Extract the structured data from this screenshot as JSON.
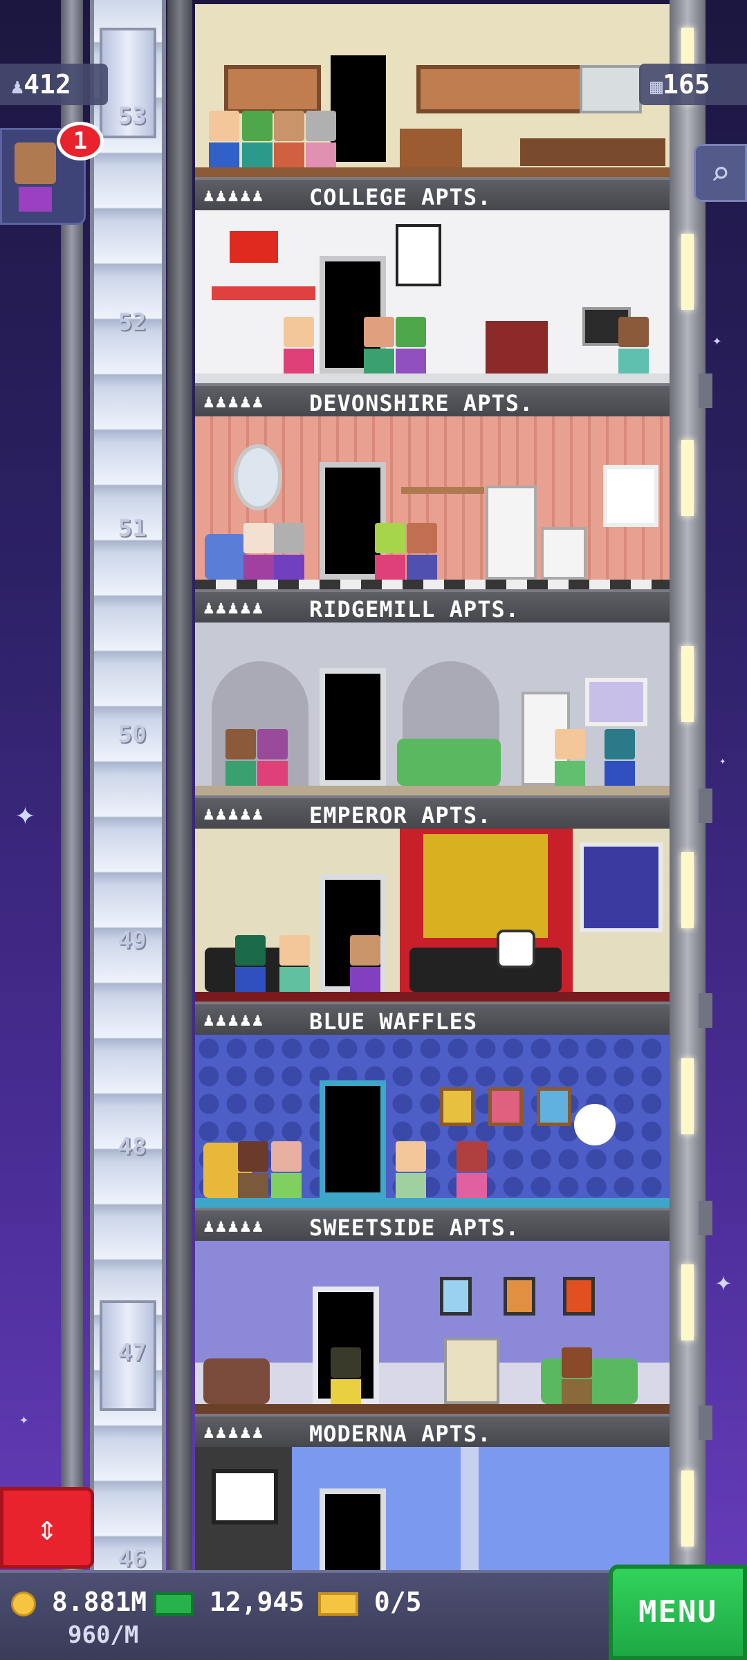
{
  "hud": {
    "population": "412",
    "floors": "165",
    "notification_count": "1",
    "coins": "8.881M",
    "income": "960/M",
    "bux": "12,945",
    "tickets": "0/5",
    "menu_label": "MENU"
  },
  "people_icons": "♟♟♟♟♟",
  "floors": [
    {
      "number": "53",
      "name": "COLLEGE APTS.",
      "wall": "#e8e0bf",
      "floor": "#8c5a36"
    },
    {
      "number": "52",
      "name": "DEVONSHIRE APTS.",
      "wall": "#f2f2f4",
      "floor": "#dcdde0"
    },
    {
      "number": "51",
      "name": "RIDGEMILL APTS.",
      "wall": "#e8a090",
      "floor": "#353535"
    },
    {
      "number": "50",
      "name": "EMPEROR APTS.",
      "wall": "#c7c9d4",
      "floor": "#b9a98e"
    },
    {
      "number": "49",
      "name": "BLUE WAFFLES",
      "wall": "#e5ddc0",
      "floor": "#7a1a1f"
    },
    {
      "number": "48",
      "name": "SWEETSIDE APTS.",
      "wall": "#4d5ec7",
      "floor": "#3ea7c8"
    },
    {
      "number": "47",
      "name": "MODERNA APTS.",
      "wall": "#8c8ad8",
      "floor": "#6b4028"
    }
  ],
  "partial_floor": {
    "number": "46",
    "wall": "#7b99ee"
  }
}
